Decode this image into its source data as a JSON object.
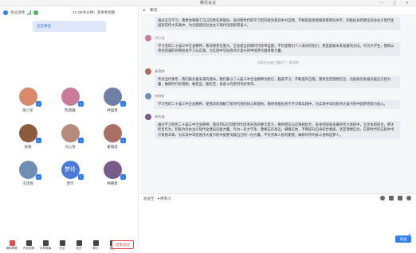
{
  "window": {
    "title": "腾讯会议",
    "controls": "— ▢ ✕"
  },
  "left_top": {
    "meeting_info": "会议详情",
    "timer": "21:48(共分钟)",
    "speaker_view": "演讲者视图"
  },
  "talking_tag": "正在讲话",
  "participants": [
    {
      "name": "张小军",
      "color": "#d98a6a"
    },
    {
      "name": "陈丽雅",
      "color": "#c97b9c"
    },
    {
      "name": "林国星",
      "color": "#6f7fa6"
    },
    {
      "name": "张雨",
      "color": "#8c5b3d"
    },
    {
      "name": "冯心怡",
      "color": "#b78b7b"
    },
    {
      "name": "秦锡思",
      "color": "#a86f62"
    },
    {
      "name": "王佳薇",
      "color": "#6e8fb3"
    },
    {
      "name": "梦玲",
      "color": "#4a7bd9",
      "initials": "梦玲"
    },
    {
      "name": "林朝星",
      "color": "#7a5c8a"
    }
  ],
  "toolbar": {
    "items": [
      "解除静音",
      "开启视频",
      "共享屏幕",
      "安全",
      "成员",
      "聊天",
      "更多"
    ],
    "leave": "结束会议"
  },
  "chat": {
    "header": "聊天",
    "messages": [
      {
        "name": "",
        "color": "#ffffff",
        "text": "通过这次学习，我更加明确了自己的责任和使命。面对新时代的学习型的政治和其中对自我，不断提高思想和政策理论水平，积极投身到建设社会主义现代化国家的伟大实践中，为全面建设社会主义现代化国家而奋斗。"
      },
      {
        "name": "洪心洁",
        "color": "#c97b9c",
        "text": "学习党的二十届三中全会精神，我深感责任重大。全会提出的新时代改革蓝图，不仅是我们个人成长的指引，更是国家未来发展的方向。作为大学生，我将以更加饱满的热情投身学习与实践，为实现中华民族伟大复兴的中国梦贡献青春力量。"
      },
      {
        "system": "消息发送者已撤回了一条消息"
      },
      {
        "name": "秦雪婷",
        "color": "#a86f62",
        "text": "作为当代青年，我们肩负着未来的使命。我们要以二十届三中全会精神为指引，勤奋学习，不断提升自我。我将坚定理想信念，为国家的发展贡献自己的力量，做新时代有理想、敢担当、能吃苦、肯奋斗的新时代好青年。"
      },
      {
        "name": "何晓妍",
        "color": "#6e8fb3",
        "text": "学习党的二十届三中全会精神，使我深刻理解了新时代党的初心和使命。我将积极投身于学习和实践中，为实现中华民族伟大复兴的中国梦而努力奋斗。"
      },
      {
        "name": "林利溶",
        "color": "#7a5c8a",
        "text": "通过学习党的二十届三中全会精神，我深刻认识到新时代改革开放的重大意义，要将理论与实践相结合，投身到国家发展的伟大进程中，立足本职岗位，勇于担当作为，积极为社会主义现代化建设贡献力量。作为一名大学生，我要志存高远，脚踏实地，不断提升自身综合素质，坚定理想信念，在新时代的征程中书写青春华章，为实现中华民族伟大复兴的中国梦贡献自己的一份力量，不负党和人民的期望，做新时代的奋斗者和追梦人。"
      }
    ],
    "composer": {
      "send_to_label": "发送至",
      "send_to_value": "所有人",
      "placeholder": "",
      "send_label": "发送"
    }
  }
}
